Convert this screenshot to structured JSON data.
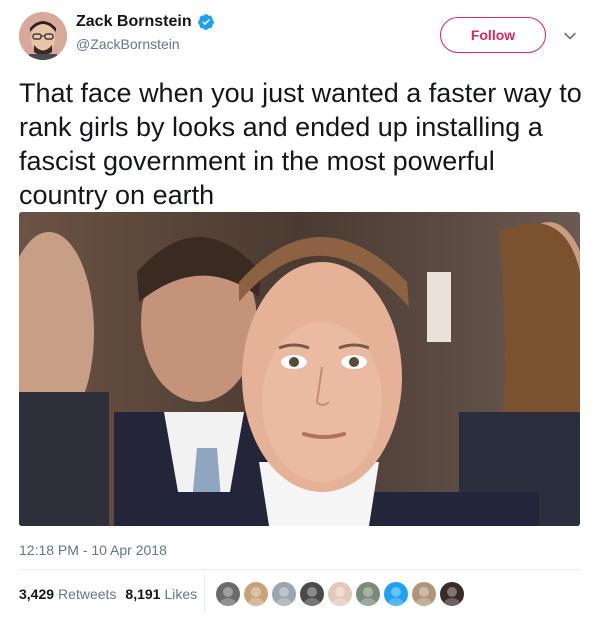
{
  "author": {
    "display_name": "Zack Bornstein",
    "handle": "@ZackBornstein",
    "verified": true
  },
  "follow_label": "Follow",
  "tweet_text": "That face when you just wanted a faster way to rank girls by looks and ended up installing a fascist government in the most powerful country on earth",
  "timestamp": "12:18 PM - 10 Apr 2018",
  "stats": {
    "retweets_count": "3,429",
    "retweets_label": "Retweets",
    "likes_count": "8,191",
    "likes_label": "Likes"
  },
  "colors": {
    "accent": "#e0245e",
    "verified_blue": "#1da1f2",
    "secondary_text": "#657786"
  },
  "icons": [
    "verified-badge-icon",
    "chevron-down-icon"
  ],
  "liker_avatars": [
    "#6b6b6b",
    "#c9a27a",
    "#9aa5ad",
    "#4a4a4a",
    "#e3c9b8",
    "#7a8b7a",
    "#1da1f2",
    "#b0957a",
    "#3a2a2a"
  ]
}
